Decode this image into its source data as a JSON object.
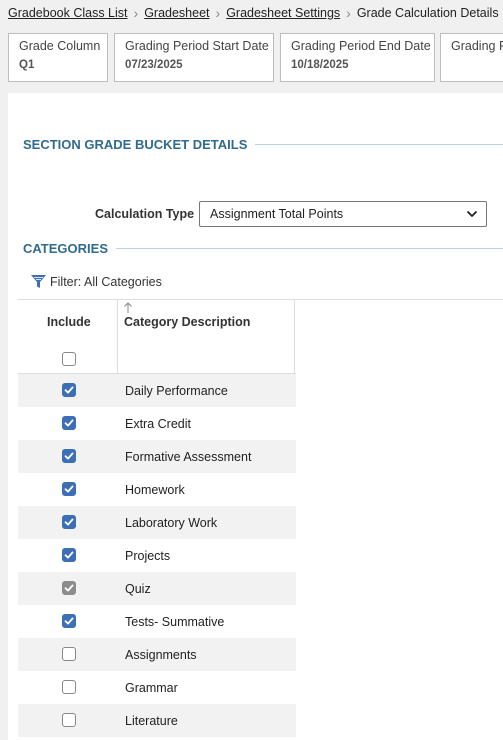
{
  "breadcrumb": {
    "items": [
      "Gradebook Class List",
      "Gradesheet",
      "Gradesheet Settings"
    ],
    "current": "Grade Calculation Details"
  },
  "tiles": [
    {
      "label": "Grade Column",
      "value": "Q1"
    },
    {
      "label": "Grading Period Start Date",
      "value": "07/23/2025"
    },
    {
      "label": "Grading Period End Date",
      "value": "10/18/2025"
    },
    {
      "label": "Grading P",
      "value": ""
    }
  ],
  "section_bucket": {
    "title": "SECTION GRADE BUCKET DETAILS"
  },
  "calc": {
    "label": "Calculation Type",
    "value": "Assignment Total Points"
  },
  "categories": {
    "title": "CATEGORIES",
    "filter_label": "Filter: All Categories",
    "col_include": "Include",
    "col_desc": "Category Description",
    "rows": [
      {
        "desc": "Daily Performance",
        "state": "checked"
      },
      {
        "desc": "Extra Credit",
        "state": "checked"
      },
      {
        "desc": "Formative Assessment",
        "state": "checked"
      },
      {
        "desc": "Homework",
        "state": "checked"
      },
      {
        "desc": "Laboratory Work",
        "state": "checked"
      },
      {
        "desc": "Projects",
        "state": "checked"
      },
      {
        "desc": "Quiz",
        "state": "checked-disabled"
      },
      {
        "desc": "Tests- Summative",
        "state": "checked"
      },
      {
        "desc": "Assignments",
        "state": "unchecked"
      },
      {
        "desc": "Grammar",
        "state": "unchecked"
      },
      {
        "desc": "Literature",
        "state": "unchecked"
      }
    ]
  },
  "colors": {
    "accent": "#2f6b8f",
    "checkbox": "#3d6fb6",
    "checkbox_disabled": "#8c8c8c"
  }
}
